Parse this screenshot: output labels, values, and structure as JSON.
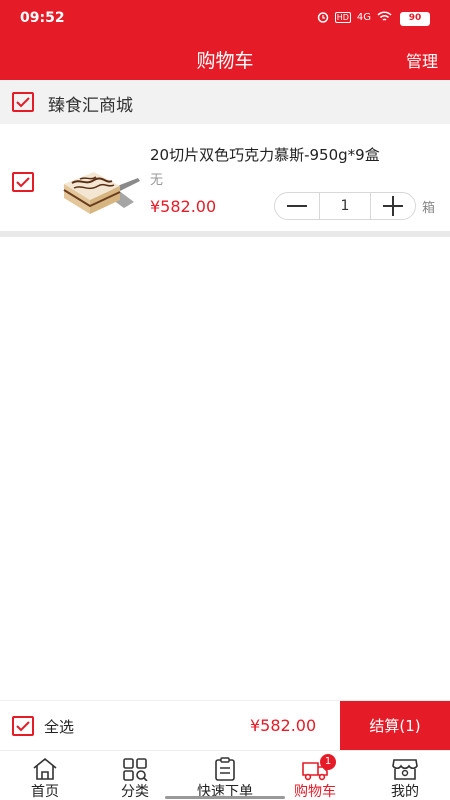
{
  "status_bar": {
    "time": "09:52",
    "network": "4G",
    "hd": "HD",
    "battery": "90"
  },
  "header": {
    "title": "购物车",
    "manage": "管理"
  },
  "shop": {
    "name": "臻食汇商城",
    "checked": true
  },
  "cart_items": [
    {
      "title": "20切片双色巧克力慕斯-950g*9盒",
      "spec": "无",
      "price": "¥582.00",
      "quantity": "1",
      "unit": "箱",
      "checked": true
    }
  ],
  "checkout": {
    "select_all": "全选",
    "total": "¥582.00",
    "button": "结算(1)"
  },
  "tabs": [
    {
      "label": "首页",
      "icon": "home-icon"
    },
    {
      "label": "分类",
      "icon": "category-icon"
    },
    {
      "label": "快速下单",
      "icon": "clipboard-icon"
    },
    {
      "label": "购物车",
      "icon": "cart-truck-icon",
      "badge": "1",
      "active": true
    },
    {
      "label": "我的",
      "icon": "profile-store-icon"
    }
  ],
  "colors": {
    "brand": "#e51c28",
    "page_bg": "#ffffff",
    "section_bg": "#f2f2f2"
  }
}
